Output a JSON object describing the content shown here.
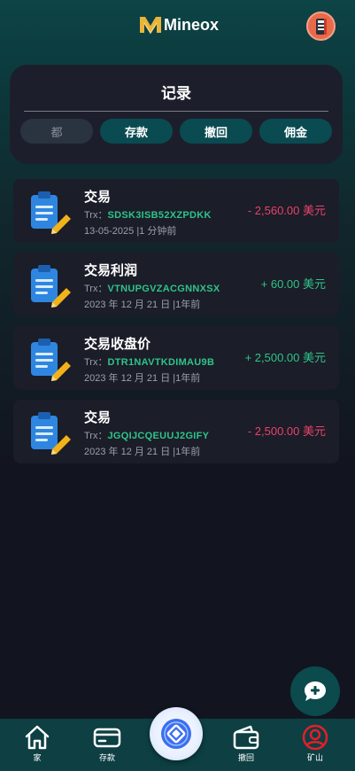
{
  "header": {
    "brand": "Mineox"
  },
  "panel": {
    "title": "记录",
    "tabs": [
      "都",
      "存款",
      "撤回",
      "佣金"
    ]
  },
  "transactions": [
    {
      "title": "交易",
      "id_prefix": "Trx：",
      "id": "SDSK3ISB52XZPDKK",
      "date": "13-05-2025 |1 分钟前",
      "amount": "- 2,560.00 美元",
      "sign": "negative"
    },
    {
      "title": "交易利润",
      "id_prefix": "Trx：",
      "id": "VTNUPGVZACGNNXSX",
      "date": "2023 年 12 月 21 日 |1年前",
      "amount": "+ 60.00 美元",
      "sign": "positive"
    },
    {
      "title": "交易收盘价",
      "id_prefix": "Trx：",
      "id": "DTR1NAVTKDIMAU9B",
      "date": "2023 年 12 月 21 日 |1年前",
      "amount": "+ 2,500.00 美元",
      "sign": "positive"
    },
    {
      "title": "交易",
      "id_prefix": "Trx：",
      "id": "JGQIJCQEUUJ2GIFY",
      "date": "2023 年 12 月 21 日 |1年前",
      "amount": "- 2,500.00 美元",
      "sign": "negative"
    }
  ],
  "bottom_nav": {
    "home": "家",
    "deposit": "存款",
    "withdraw": "撤回",
    "mining": "矿山"
  },
  "colors": {
    "accent": "#0a4b52",
    "positive": "#2ec48a",
    "negative": "#e8426a",
    "card": "#1b1d28"
  }
}
